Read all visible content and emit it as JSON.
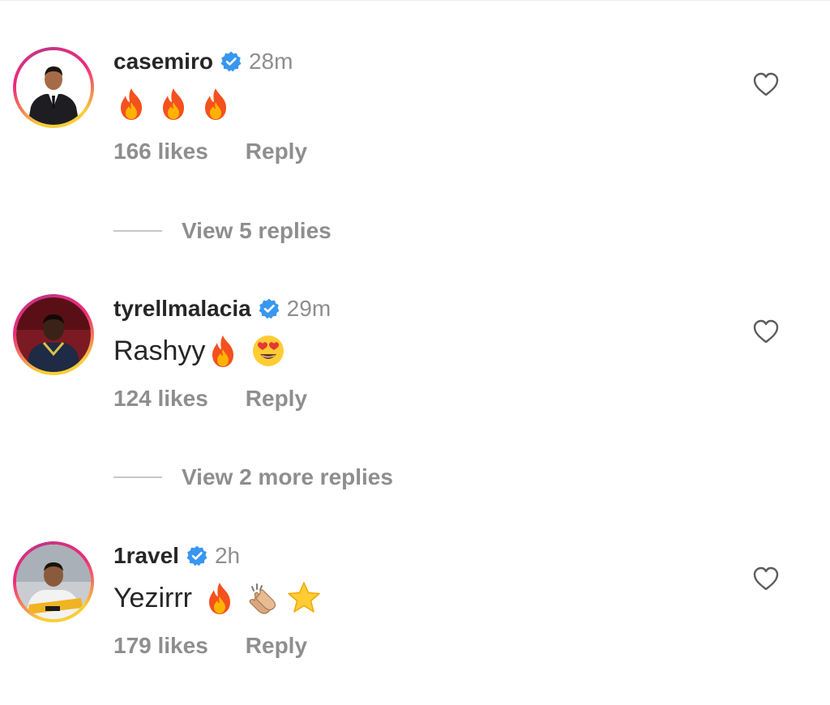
{
  "comments": [
    {
      "username": "casemiro",
      "time": "28m",
      "text": "",
      "emojis": [
        "fire",
        "fire",
        "fire"
      ],
      "likes": "166 likes",
      "reply": "Reply",
      "verified": true,
      "view_replies": "View 5 replies"
    },
    {
      "username": "tyrellmalacia",
      "time": "29m",
      "text": "Rashyy",
      "emojis": [
        "fire",
        "heart-eyes"
      ],
      "likes": "124 likes",
      "reply": "Reply",
      "verified": true,
      "view_replies": "View 2 more replies"
    },
    {
      "username": "1ravel",
      "time": "2h",
      "text": "Yezirrr",
      "emojis": [
        "fire",
        "clapping-hands",
        "star"
      ],
      "likes": "179 likes",
      "reply": "Reply",
      "verified": true
    }
  ],
  "colors": {
    "verified_blue": "#3897f0",
    "secondary_text": "#8e8e8e",
    "primary_text": "#262626"
  },
  "icons": {
    "like": "heart-outline-icon",
    "verified": "verified-badge-icon"
  }
}
